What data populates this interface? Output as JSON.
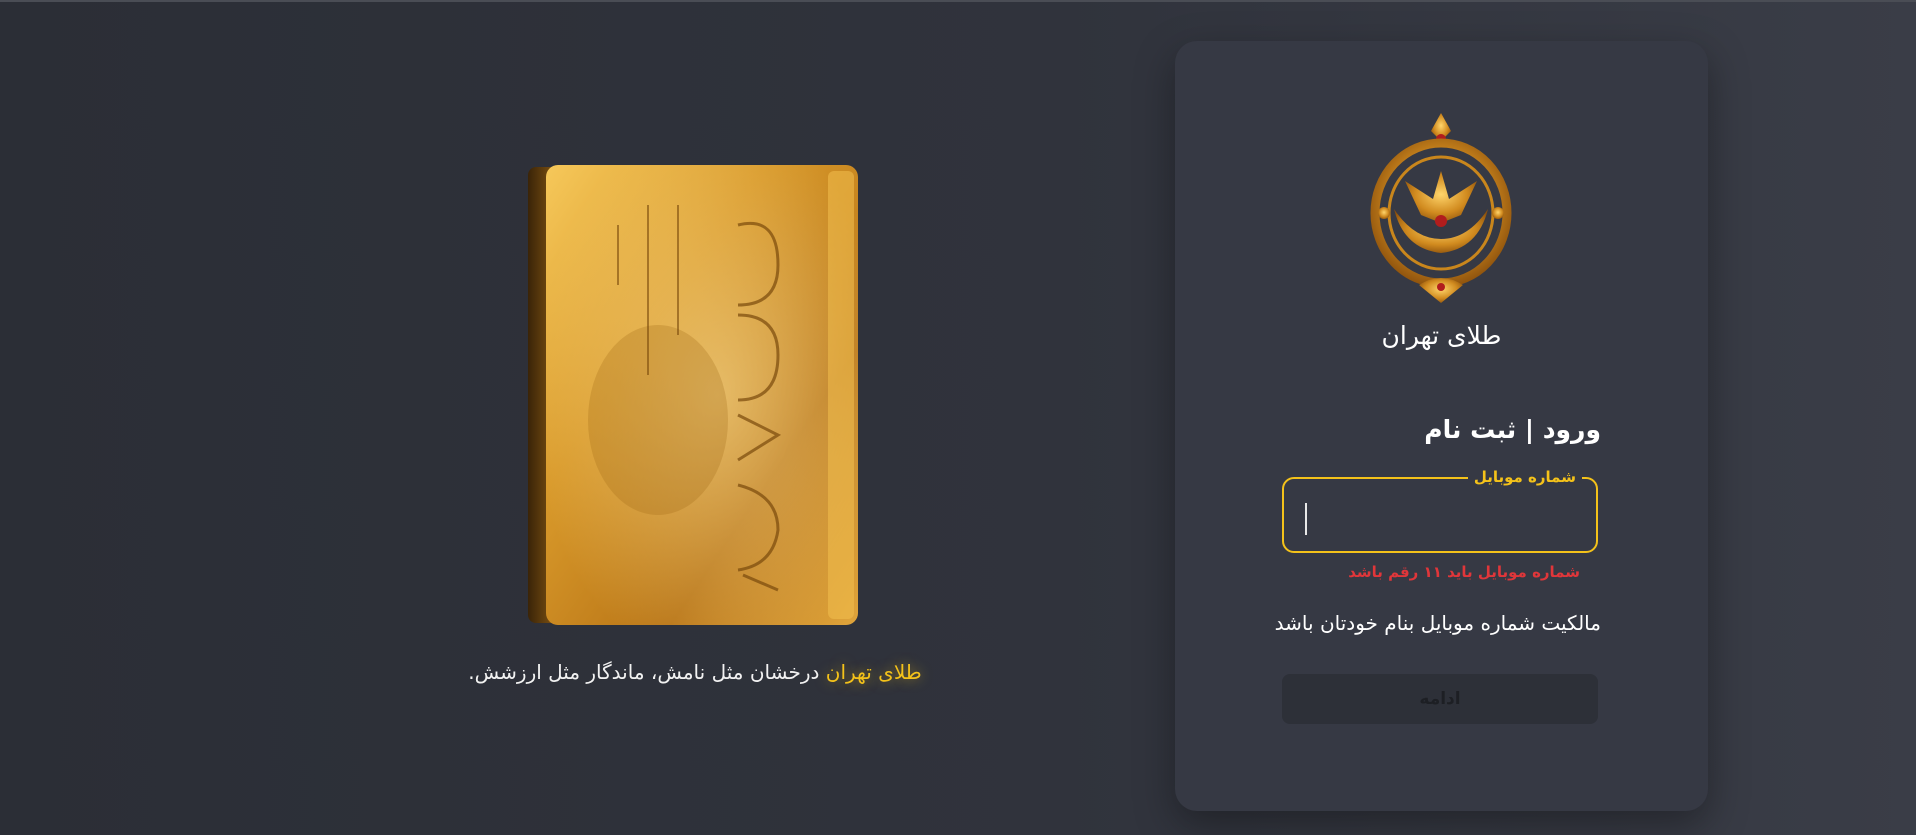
{
  "hero": {
    "brand_highlight": "طلای تهران",
    "tagline_rest": " درخشان مثل نامش، ماندگار مثل ارزشش."
  },
  "card": {
    "brand_name": "طلای تهران",
    "title": "ورود | ثبت نام",
    "mobile_field": {
      "label": "شماره موبایل",
      "value": "",
      "error": "شماره موبایل باید ۱۱ رقم باشد"
    },
    "hint": "مالکیت شماره موبایل بنام خودتان باشد",
    "continue_label": "ادامه"
  },
  "colors": {
    "accent_gold": "#f4c21a",
    "error_red": "#e0363a",
    "card_bg": "#363944"
  },
  "icons": {
    "logo": "gold-emblem-icon",
    "hero": "gold-bar-image"
  }
}
